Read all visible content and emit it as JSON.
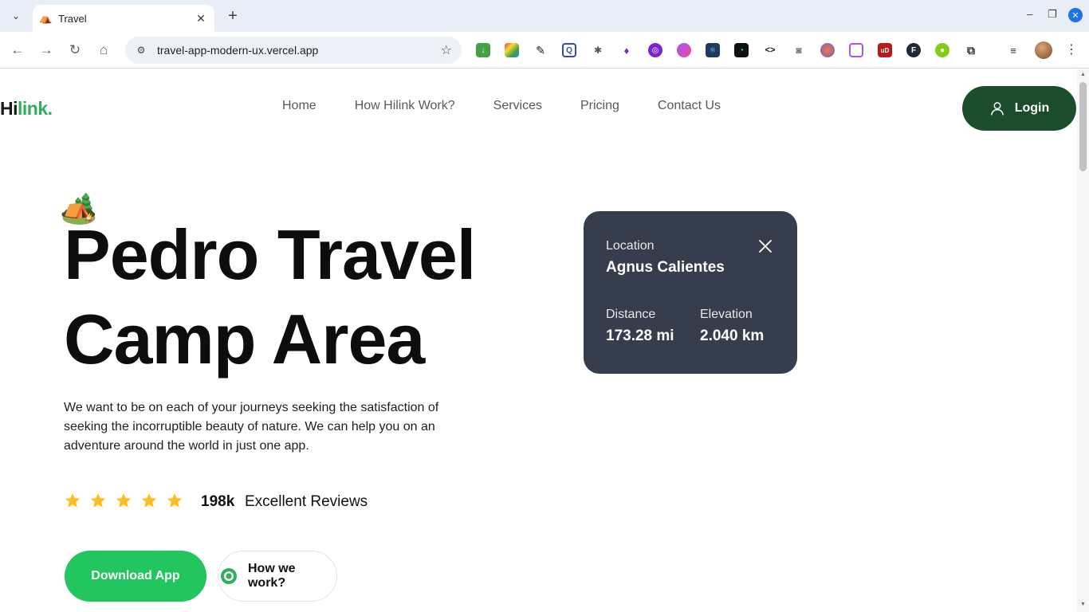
{
  "browser": {
    "tab_title": "Travel",
    "tab_favicon": "⛺",
    "url": "travel-app-modern-ux.vercel.app"
  },
  "site": {
    "logo_hi": "Hi",
    "logo_link": "link.",
    "nav": [
      "Home",
      "How Hilink Work?",
      "Services",
      "Pricing",
      "Contact Us"
    ],
    "login_label": "Login"
  },
  "hero": {
    "emoji": "🏕️",
    "title_line1": "Pedro Travel",
    "title_line2": "Camp Area",
    "description": "We want to be on each of your journeys seeking the satisfaction of seeking the incorruptible beauty of nature. We can help you on an adventure around the world in just one app.",
    "rating_stars": 5,
    "review_count": "198k",
    "review_label": "Excellent Reviews",
    "download_label": "Download App",
    "how_label": "How we work?"
  },
  "card": {
    "location_label": "Location",
    "location_value": "Agnus Calientes",
    "distance_label": "Distance",
    "distance_value": "173.28 mi",
    "elevation_label": "Elevation",
    "elevation_value": "2.040 km"
  },
  "colors": {
    "brand_green": "#30af5b",
    "login_bg": "#1b4d2c",
    "download_bg": "#22c55e",
    "card_bg": "#363d4c",
    "star": "#fbbf24"
  }
}
